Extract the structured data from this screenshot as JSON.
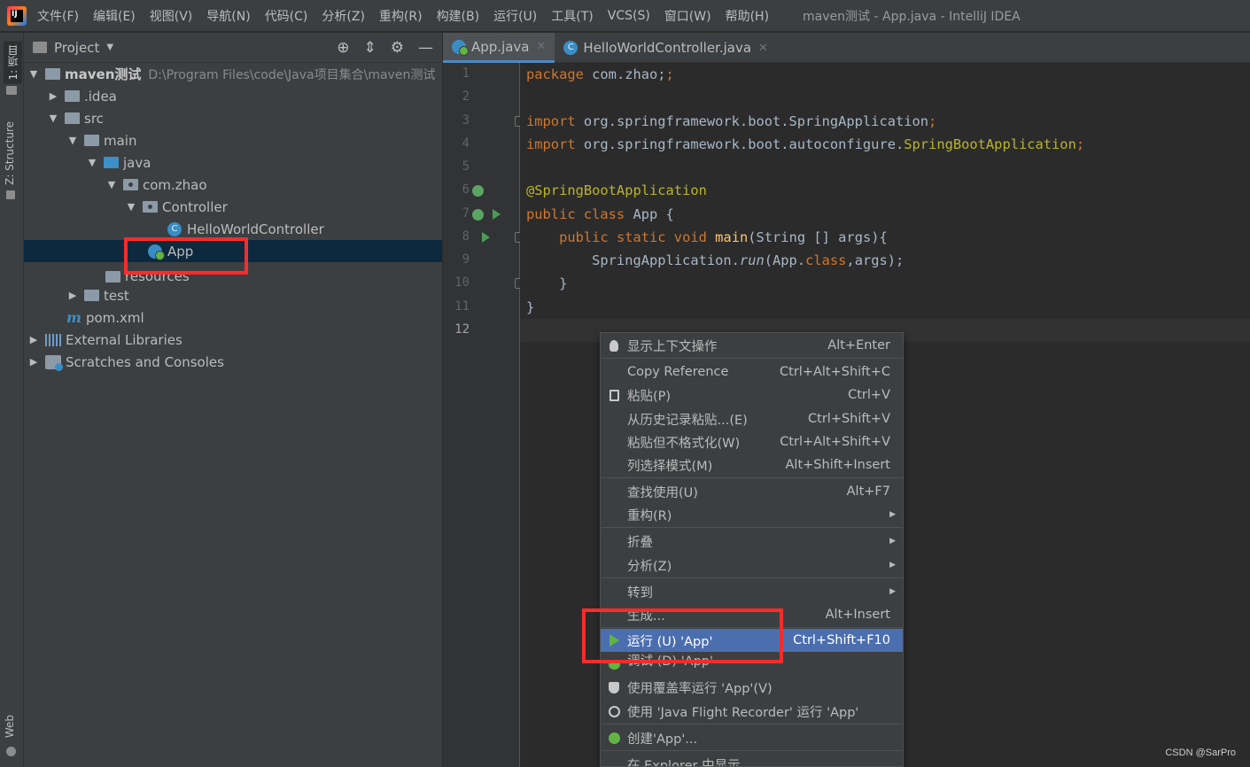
{
  "menubar": {
    "logo": "IJ",
    "items": [
      "文件(F)",
      "编辑(E)",
      "视图(V)",
      "导航(N)",
      "代码(C)",
      "分析(Z)",
      "重构(R)",
      "构建(B)",
      "运行(U)",
      "工具(T)",
      "VCS(S)",
      "窗口(W)",
      "帮助(H)"
    ],
    "window_title": "maven测试 - App.java - IntelliJ IDEA"
  },
  "toolstrip": {
    "tabs": [
      "1: 项目",
      "Z: Structure",
      "Web"
    ]
  },
  "project_panel": {
    "title": "Project",
    "tree": [
      {
        "label": "maven测试",
        "path": "D:\\Program Files\\code\\Java项目集合\\maven测试"
      },
      {
        "label": ".idea"
      },
      {
        "label": "src"
      },
      {
        "label": "main"
      },
      {
        "label": "java"
      },
      {
        "label": "com.zhao"
      },
      {
        "label": "Controller"
      },
      {
        "label": "HelloWorldController"
      },
      {
        "label": "App"
      },
      {
        "label": "resources"
      },
      {
        "label": "test"
      },
      {
        "label": "pom.xml"
      },
      {
        "label": "External Libraries"
      },
      {
        "label": "Scratches and Consoles"
      }
    ]
  },
  "editor": {
    "tabs": [
      {
        "label": "App.java",
        "active": true
      },
      {
        "label": "HelloWorldController.java",
        "active": false
      }
    ],
    "line_numbers": [
      "1",
      "2",
      "3",
      "4",
      "5",
      "6",
      "7",
      "8",
      "9",
      "10",
      "11",
      "12"
    ],
    "code": {
      "l1_kw": "package",
      "l1_rest": " com.zhao;",
      "l3_kw": "import",
      "l3_rest": " org.springframework.boot.SpringApplication",
      "l3_semi": ";",
      "l4_kw": "import",
      "l4_rest": " org.springframework.boot.autoconfigure.",
      "l4_ann": "SpringBootApplication",
      "l4_semi": ";",
      "l6_ann": "@SpringBootApplication",
      "l7_kw": "public class",
      "l7_rest": " App {",
      "l8_indent": "    ",
      "l8_kw": "public static void",
      "l8_sp": " ",
      "l8_fn": "main",
      "l8_rest": "(String [] args){",
      "l9_indent": "        SpringApplication.",
      "l9_it": "run",
      "l9_a": "(App.",
      "l9_kw": "class",
      "l9_b": ",args);",
      "l10": "    }",
      "l11": "}"
    }
  },
  "context_menu": {
    "items": [
      {
        "label": "显示上下文操作",
        "shortcut": "Alt+Enter"
      },
      {
        "label": "Copy Reference",
        "shortcut": "Ctrl+Alt+Shift+C"
      },
      {
        "label": "粘贴(P)",
        "shortcut": "Ctrl+V"
      },
      {
        "label": "从历史记录粘贴...(E)",
        "shortcut": "Ctrl+Shift+V"
      },
      {
        "label": "粘贴但不格式化(W)",
        "shortcut": "Ctrl+Alt+Shift+V"
      },
      {
        "label": "列选择模式(M)",
        "shortcut": "Alt+Shift+Insert"
      },
      {
        "label": "查找使用(U)",
        "shortcut": "Alt+F7"
      },
      {
        "label": "重构(R)",
        "submenu": true
      },
      {
        "label": "折叠",
        "submenu": true
      },
      {
        "label": "分析(Z)",
        "submenu": true
      },
      {
        "label": "转到",
        "submenu": true
      },
      {
        "label": "生成...",
        "shortcut": "Alt+Insert"
      },
      {
        "label": "运行 (U) 'App'",
        "shortcut": "Ctrl+Shift+F10"
      },
      {
        "label": "调试 (D) 'App'"
      },
      {
        "label": "使用覆盖率运行 'App'(V)"
      },
      {
        "label": "使用 'Java Flight Recorder' 运行 'App'"
      },
      {
        "label": "创建'App'..."
      },
      {
        "label": "在 Explorer 中显示"
      }
    ]
  },
  "watermark": "CSDN @SarPro",
  "colors": {
    "accent": "#4b6eaf",
    "highlight": "#ff2a2a",
    "run_green": "#62b543"
  }
}
